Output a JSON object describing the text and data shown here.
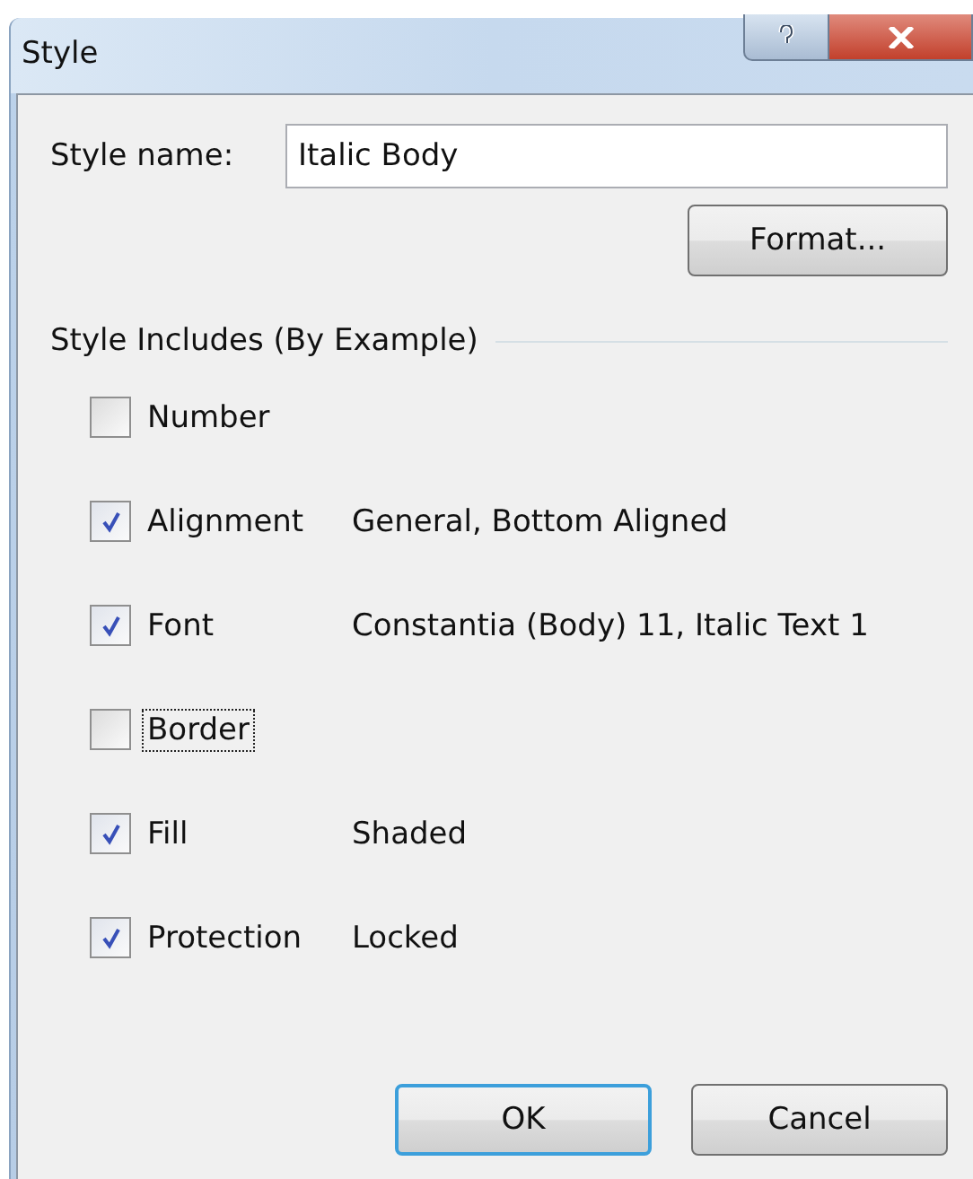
{
  "window": {
    "title": "Style"
  },
  "style_name": {
    "label": "Style name:",
    "value": "Italic Body"
  },
  "format_button": "Format...",
  "group": {
    "title": "Style Includes (By Example)",
    "items": [
      {
        "label": "Number",
        "checked": false,
        "focused": false
      },
      {
        "label": "Alignment",
        "checked": true,
        "focused": false,
        "value": "General, Bottom Aligned"
      },
      {
        "label": "Font",
        "checked": true,
        "focused": false,
        "value": "Constantia (Body) 11, Italic Text 1"
      },
      {
        "label": "Border",
        "checked": false,
        "focused": true
      },
      {
        "label": "Fill",
        "checked": true,
        "focused": false,
        "value": "Shaded"
      },
      {
        "label": "Protection",
        "checked": true,
        "focused": false,
        "value": "Locked"
      }
    ]
  },
  "buttons": [
    {
      "label": "OK",
      "default": true
    },
    {
      "label": "Cancel",
      "default": false
    }
  ]
}
